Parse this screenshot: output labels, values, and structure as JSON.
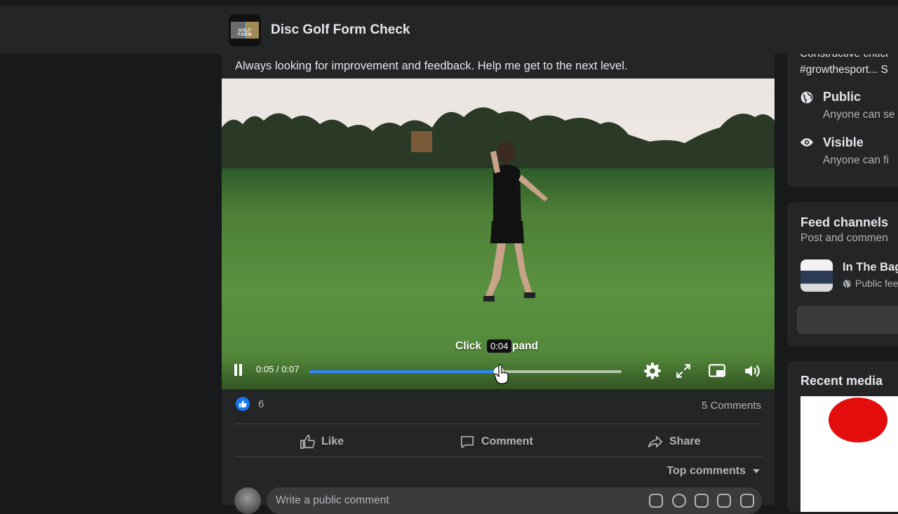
{
  "header": {
    "group_name": "Disc Golf Form Check",
    "group_thumb_text": "GOLF FORM"
  },
  "post": {
    "caption": "Always looking for improvement and feedback. Help me get to the next level.",
    "video": {
      "overlay_left": "Click",
      "overlay_right": "pand",
      "hover_time": "0:04",
      "time_display": "0:05 / 0:07",
      "progress": 0.607
    },
    "reaction_count": "6",
    "comments_count": "5 Comments",
    "actions": {
      "like": "Like",
      "comment": "Comment",
      "share": "Share"
    },
    "sort_label": "Top comments",
    "comment_placeholder": "Write a public comment"
  },
  "sidebar": {
    "about_snippet_1": "Constructive critici",
    "about_snippet_2": "#growthesport... S",
    "privacy_title": "Public",
    "privacy_desc": "Anyone can se",
    "visibility_title": "Visible",
    "visibility_desc": "Anyone can fi",
    "feed_title": "Feed channels",
    "feed_sub": "Post and commen",
    "channel_name": "In The Bag",
    "channel_desc": "Public fee",
    "recent_media_title": "Recent media"
  },
  "colors": {
    "accent": "#2d88ff",
    "like_blue": "#1877f2",
    "surface": "#242526",
    "background": "#18191a"
  }
}
